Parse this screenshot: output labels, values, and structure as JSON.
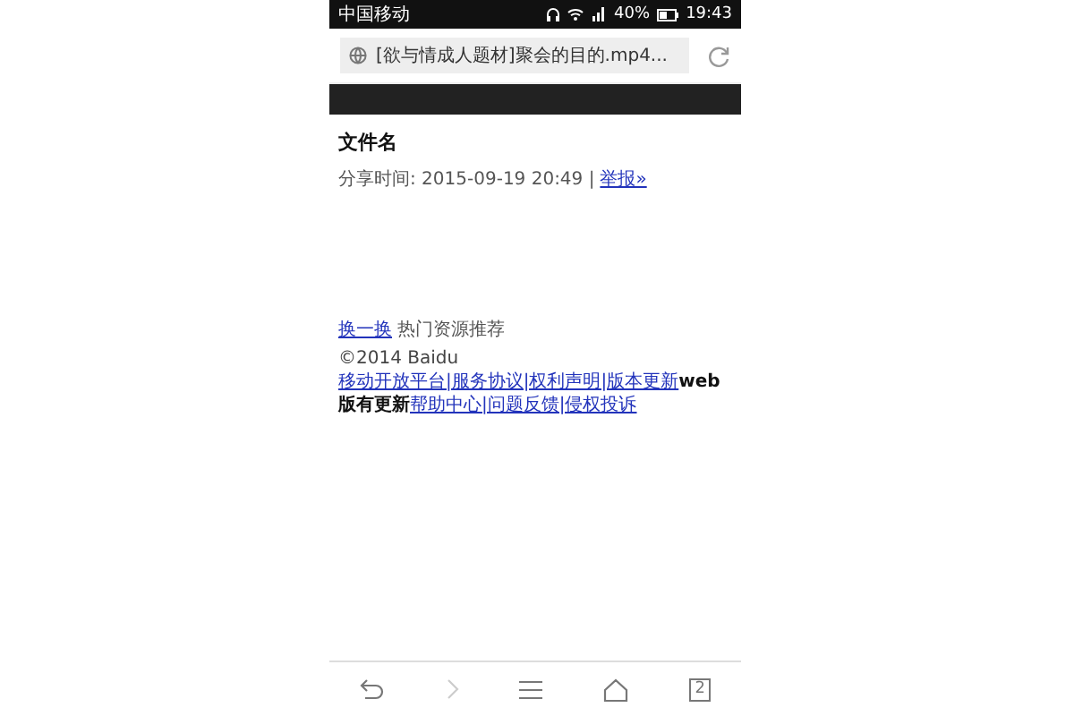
{
  "status_bar": {
    "carrier": "中国移动",
    "battery": "40%",
    "time": "19:43"
  },
  "address_bar": {
    "title": "[欲与情成人题材]聚会的目的.mp4..."
  },
  "file": {
    "title": "文件名",
    "share_time": "分享时间: 2015-09-19 20:49 |",
    "report_link": "举报»"
  },
  "recommend": {
    "link": "换一换",
    "label": "热门资源推荐"
  },
  "footer": {
    "copyright": "©2014 Baidu",
    "parts": [
      {
        "text": "移动开放平台|服务协议|权利声明|版本更新",
        "kind": "link"
      },
      {
        "text": "web版有更新",
        "kind": "bold"
      },
      {
        "text": "帮助中心|问题反馈|侵权投诉",
        "kind": "link"
      }
    ]
  },
  "toolbar": {
    "forward_disabled": true,
    "tab_count": "2"
  }
}
